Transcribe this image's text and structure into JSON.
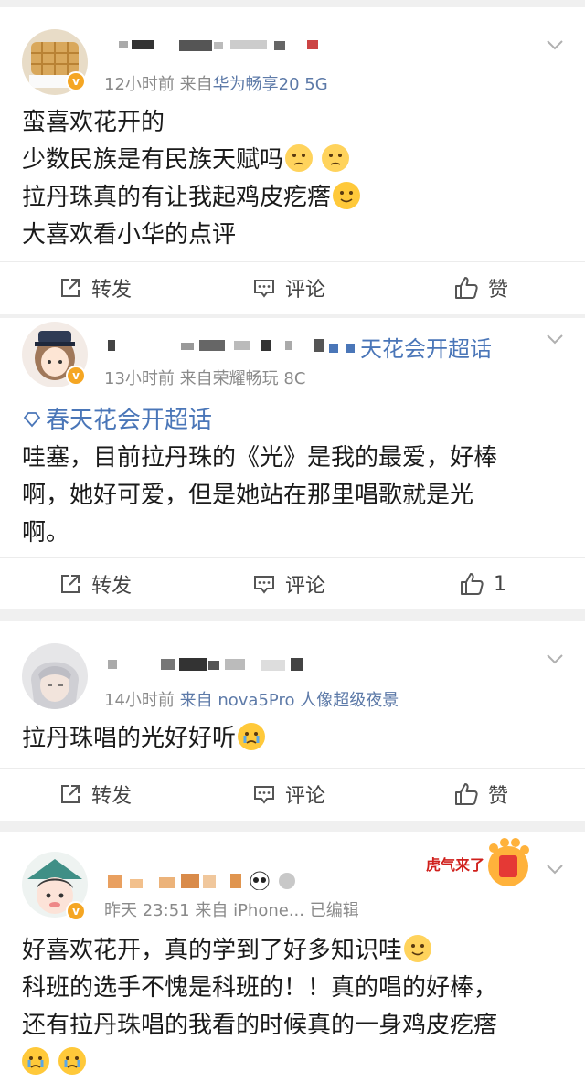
{
  "posts": [
    {
      "time": "12小时前",
      "source_prefix": "来自",
      "source": "华为畅享20 5G",
      "lines": [
        "蛮喜欢花开的",
        "少数民族是有民族天赋吗",
        "拉丹珠真的有让我起鸡皮疙瘩",
        "大喜欢看小华的点评"
      ],
      "actions": {
        "repost": "转发",
        "comment": "评论",
        "like": "赞"
      }
    },
    {
      "name_tail": "天花会开超话",
      "time": "13小时前",
      "source": "来自荣耀畅玩 8C",
      "topic": "春天花会开超话",
      "lines": [
        "哇塞，目前拉丹珠的《光》是我的最爱，好棒",
        "啊，她好可爱，但是她站在那里唱歌就是光",
        "啊。"
      ],
      "actions": {
        "repost": "转发",
        "comment": "评论",
        "like": "1"
      }
    },
    {
      "time": "14小时前",
      "source": "来自 nova5Pro 人像超级夜景",
      "lines": [
        "拉丹珠唱的光好好听"
      ],
      "actions": {
        "repost": "转发",
        "comment": "评论",
        "like": "赞"
      }
    },
    {
      "time": "昨天 23:51",
      "source": "来自 iPhone...",
      "edited": "已编辑",
      "lines": [
        "好喜欢花开，真的学到了好多知识哇",
        "科班的选手不愧是科班的！！真的唱的好棒，",
        "还有拉丹珠唱的我看的时候真的一身鸡皮疙瘩"
      ],
      "sticker_text": "虎气来了"
    }
  ],
  "icons": {
    "repost": "repost-icon",
    "comment": "comment-icon",
    "like": "thumbs-up-icon",
    "more": "chevron-down-icon",
    "verified": "verified-badge"
  },
  "colors": {
    "link": "#4a76b8",
    "source": "#5d7aa8",
    "meta": "#8a8a8a",
    "badge": "#f5a623"
  }
}
